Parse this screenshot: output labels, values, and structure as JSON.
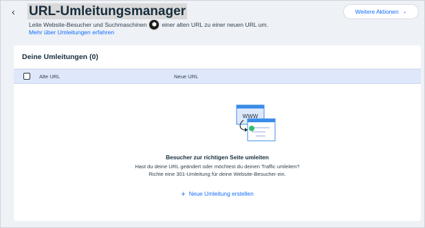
{
  "header": {
    "back_icon": "chevron-left-icon",
    "title": "URL-Umleitungsmanager",
    "subtitle_before": "Leite Website-Besucher und Suchmaschinen",
    "subtitle_after": "einer alten URL zu einer neuen URL um.",
    "learn_more": "Mehr über Umleitungen erfahren",
    "more_actions": "Weitere Aktionen"
  },
  "card": {
    "title": "Deine Umleitungen (0)",
    "columns": [
      "Alte URL",
      "Neue URL"
    ],
    "empty_state": {
      "illustration_label": "WWW",
      "title": "Besucher zur richtigen Seite umleiten",
      "text_line1": "Hast du deine URL geändert oder möchtest du deinen Traffic umleiten?",
      "text_line2": "Richte eine 301-Umleitung für deine Website-Besucher ein.",
      "create_button": "Neue Umleitung erstellen"
    }
  },
  "colors": {
    "accent": "#116dff",
    "table_header_bg": "#dfe8fb",
    "page_bg": "#eef1f6"
  }
}
